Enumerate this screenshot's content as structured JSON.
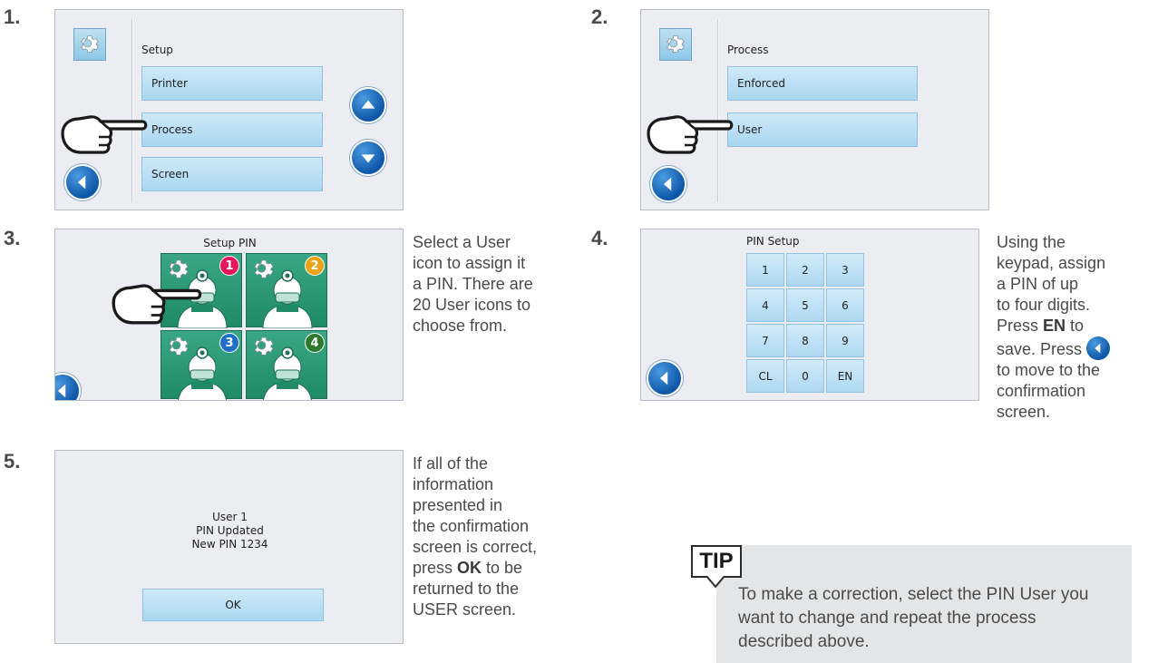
{
  "steps": {
    "s1": "1.",
    "s2": "2.",
    "s3": "3.",
    "s4": "4.",
    "s5": "5."
  },
  "screen1": {
    "title": "Setup",
    "items": [
      "Printer",
      "Process",
      "Screen"
    ]
  },
  "screen2": {
    "title": "Process",
    "items": [
      "Enforced",
      "User"
    ]
  },
  "screen3": {
    "title": "Setup PIN",
    "badges": [
      "1",
      "2",
      "3",
      "4"
    ],
    "badge_colors": [
      "#e8175d",
      "#e8a317",
      "#1f6fc4",
      "#2c7a2c"
    ]
  },
  "screen4": {
    "title": "PIN Setup",
    "keys": [
      "1",
      "2",
      "3",
      "4",
      "5",
      "6",
      "7",
      "8",
      "9",
      "CL",
      "0",
      "EN"
    ]
  },
  "screen5": {
    "line1": "User 1",
    "line2": "PIN Updated",
    "line3": "New PIN 1234",
    "ok_label": "OK"
  },
  "desc3": {
    "l1": "Select a User",
    "l2": "icon to assign it",
    "l3": "a PIN. There are",
    "l4": "20 User icons to",
    "l5": "choose from."
  },
  "desc4": {
    "l1": "Using the",
    "l2": "keypad, assign",
    "l3": "a PIN of up",
    "l4": "to four digits.",
    "l5a": "Press ",
    "l5b": "EN",
    "l5c": " to",
    "l6a": "save. Press ",
    "l7": "to move to the",
    "l8": "confirmation",
    "l9": "screen."
  },
  "desc5": {
    "l1": "If all of the",
    "l2": "information",
    "l3": "presented in",
    "l4": "the confirmation",
    "l5": "screen is correct,",
    "l6a": "press ",
    "l6b": "OK",
    "l6c": " to be",
    "l7": "returned to the",
    "l8": "USER screen."
  },
  "tip": {
    "label": "TIP",
    "text": "To make a correction, select the PIN User you want to change and repeat the process described above."
  },
  "icons": {
    "gear": "gear-icon",
    "back": "back-arrow-icon",
    "up": "up-arrow-icon",
    "down": "down-arrow-icon",
    "hand": "pointing-hand-icon"
  },
  "colors": {
    "menu_button": "#b8def3",
    "nav_blue": "#0d56a8",
    "tile_green": "#2a9a74"
  }
}
